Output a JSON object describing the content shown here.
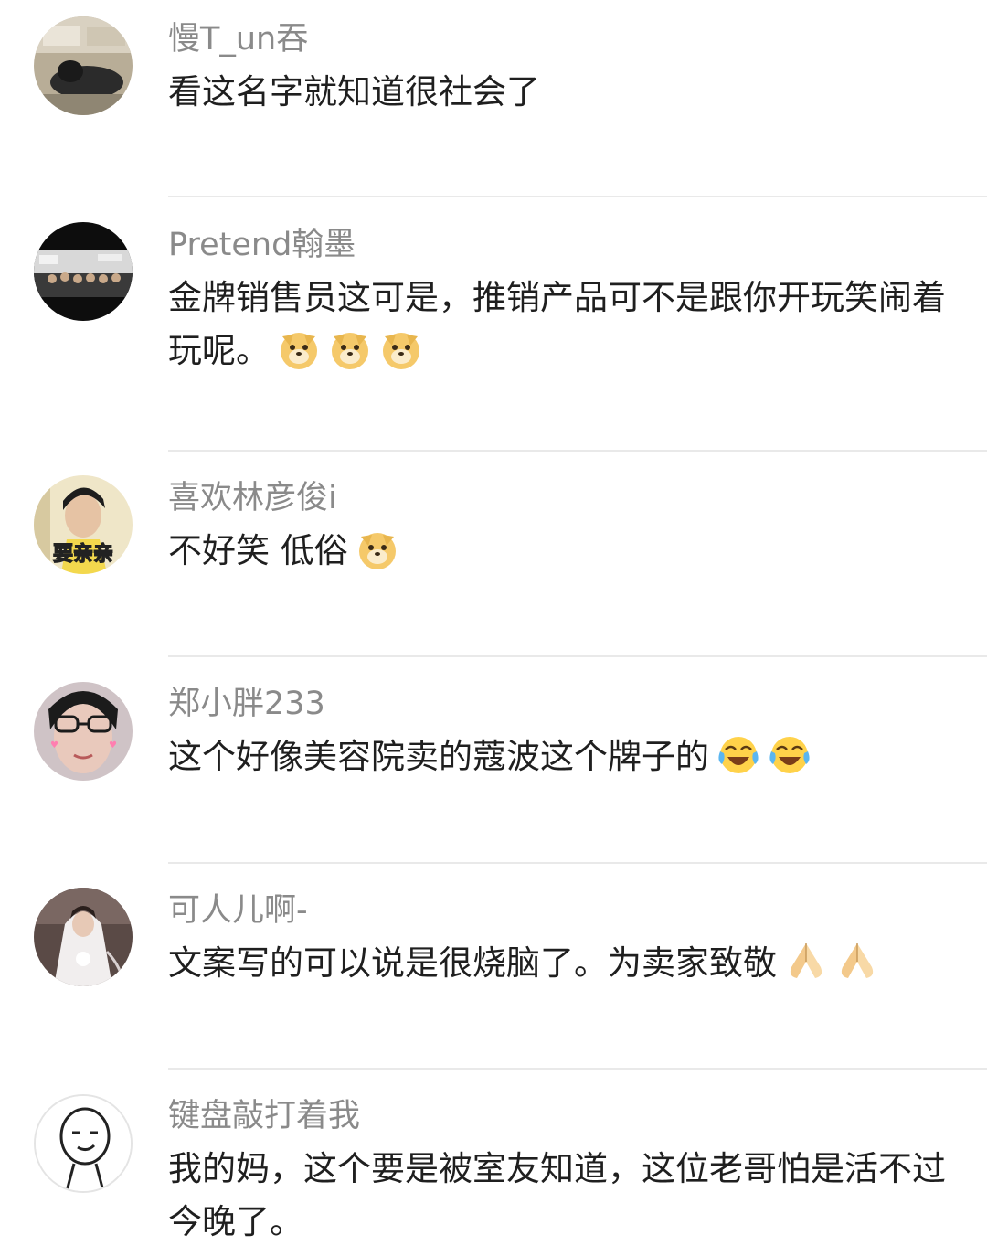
{
  "comments": [
    {
      "username": "慢T_un吞",
      "text": "看这名字就知道很社会了",
      "avatar": "avatar-person-desk",
      "emojis": []
    },
    {
      "username": "Pretend翰墨",
      "text": "金牌销售员这可是，推销产品可不是跟你开玩笑闹着玩呢。",
      "avatar": "avatar-group-photo",
      "emojis": [
        "doge-icon",
        "doge-icon",
        "doge-icon"
      ]
    },
    {
      "username": "喜欢林彦俊i",
      "text": "不好笑 低俗",
      "avatar": "avatar-idol",
      "avatar_caption": "要亲亲",
      "emojis": [
        "doge-icon"
      ]
    },
    {
      "username": "郑小胖233",
      "text": "这个好像美容院卖的蔻波这个牌子的",
      "avatar": "avatar-girl-glasses",
      "emojis": [
        "laugh-cry-icon",
        "laugh-cry-icon"
      ]
    },
    {
      "username": "可人儿啊-",
      "text": "文案写的可以说是很烧脑了。为卖家致敬",
      "avatar": "avatar-bride",
      "emojis": [
        "clasped-hands-icon",
        "clasped-hands-icon"
      ]
    },
    {
      "username": "键盘敲打着我",
      "text": "我的妈，这个要是被室友知道，这位老哥怕是活不过今晚了。",
      "avatar": "avatar-smirk-face",
      "emojis": []
    }
  ]
}
